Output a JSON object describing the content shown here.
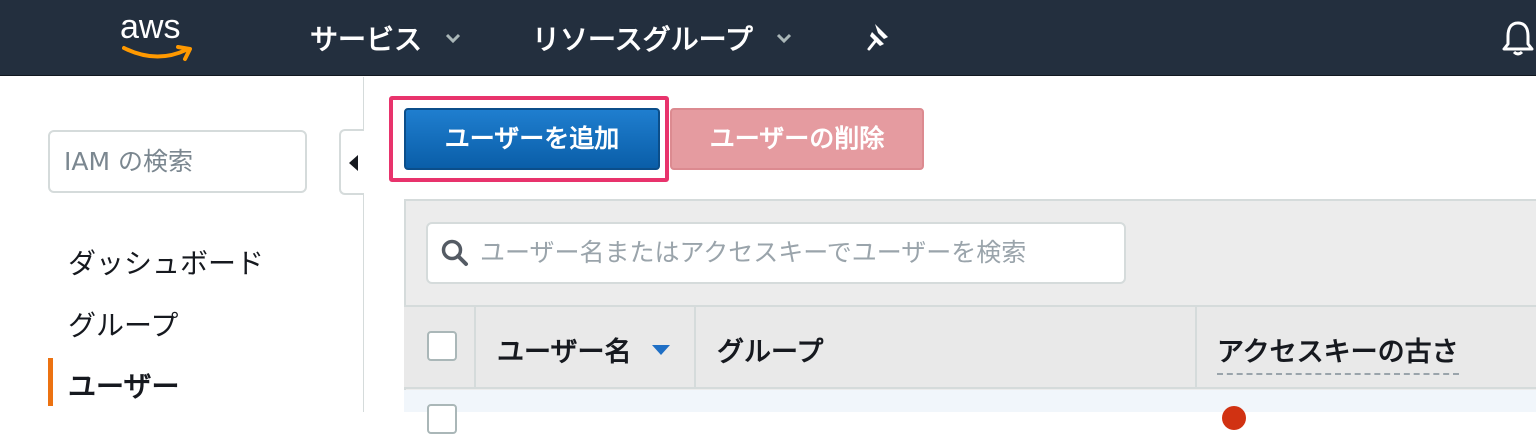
{
  "topbar": {
    "logo_text": "aws",
    "services_label": "サービス",
    "resource_groups_label": "リソースグループ",
    "icons": [
      "chevron-down-icon",
      "pin-icon",
      "bell-icon"
    ]
  },
  "sidebar": {
    "search_placeholder": "IAM の検索",
    "items": [
      {
        "label": "ダッシュボード"
      },
      {
        "label": "グループ"
      },
      {
        "label": "ユーザー",
        "active": true
      }
    ]
  },
  "toolbar": {
    "add_user_label": "ユーザーを追加",
    "delete_user_label": "ユーザーの削除"
  },
  "filter": {
    "placeholder": "ユーザー名またはアクセスキーでユーザーを検索"
  },
  "table": {
    "columns": [
      {
        "label": "ユーザー名",
        "sorted": "desc"
      },
      {
        "label": "グループ"
      },
      {
        "label": "アクセスキーの古さ"
      }
    ]
  },
  "colors": {
    "topbar_bg": "#232f3e",
    "primary_button": "#0a5ea8",
    "delete_button": "#e59ba0",
    "highlight": "#e8336c",
    "active_indicator": "#ec7211"
  }
}
